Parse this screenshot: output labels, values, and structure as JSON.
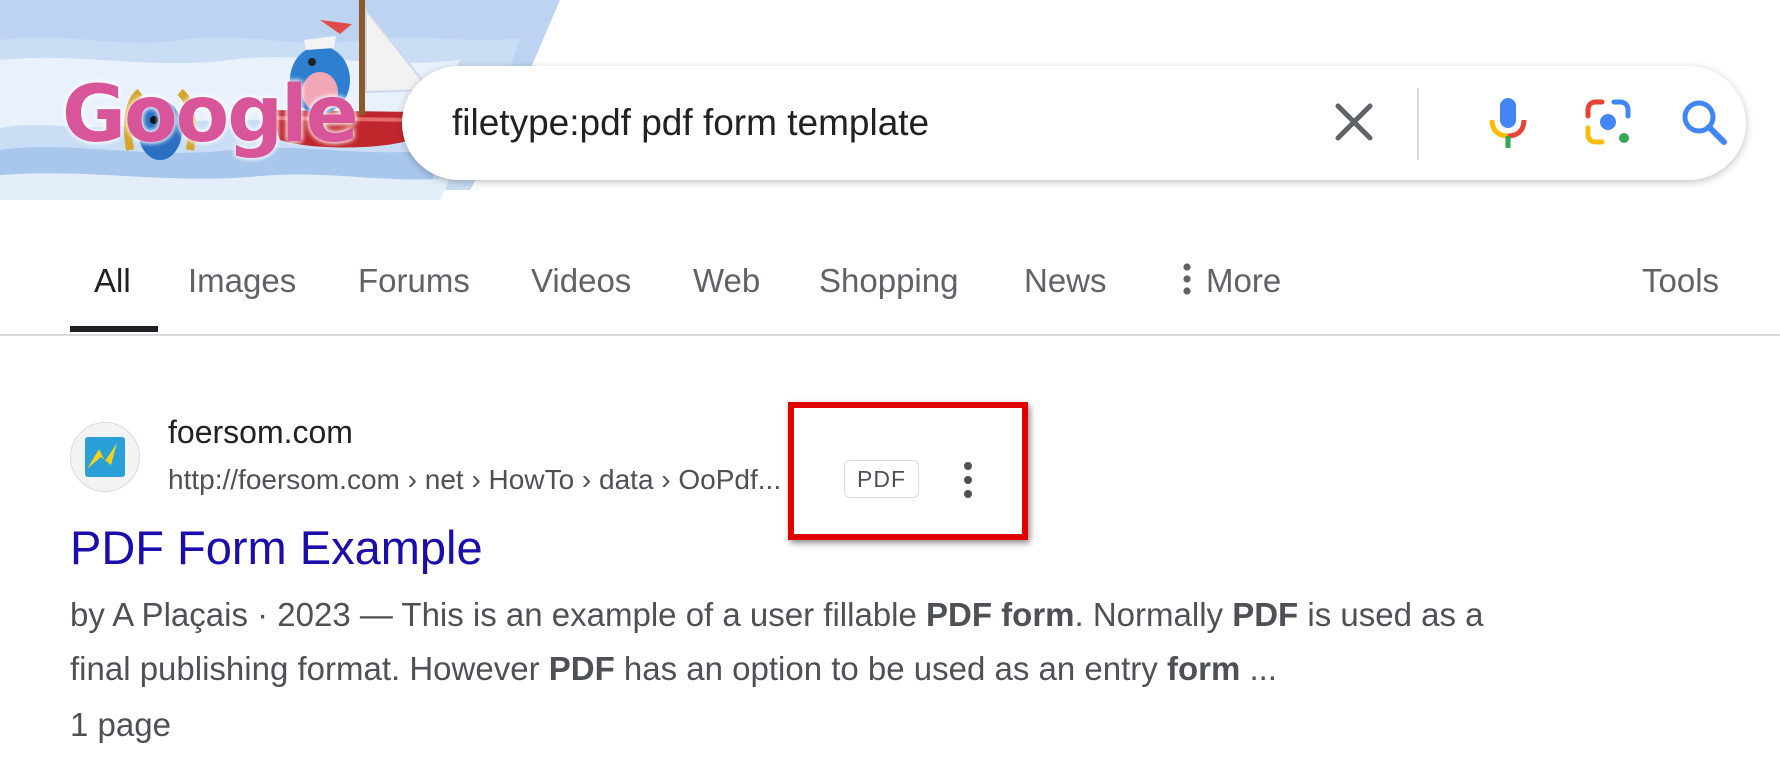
{
  "doodle": {
    "logo_text": "Google"
  },
  "search": {
    "query": "filetype:pdf pdf form template",
    "clear_icon": "close-icon",
    "voice_icon": "mic-icon",
    "lens_icon": "camera-lens-icon",
    "submit_icon": "search-icon"
  },
  "tabs": {
    "items": [
      {
        "label": "All",
        "active": true
      },
      {
        "label": "Images"
      },
      {
        "label": "Forums"
      },
      {
        "label": "Videos"
      },
      {
        "label": "Web"
      },
      {
        "label": "Shopping"
      },
      {
        "label": "News"
      },
      {
        "label": "More",
        "icon": "vertical-dots-icon"
      }
    ],
    "tools_label": "Tools"
  },
  "result": {
    "site_name": "foersom.com",
    "url": "http://foersom.com › net › HowTo › data › OoPdf...",
    "badge": "PDF",
    "title": "PDF Form Example",
    "snippet": {
      "line1": [
        {
          "text": "by A Plaçais · 2023 — This is an example of a user fillable ",
          "bold": false
        },
        {
          "text": "PDF form",
          "bold": true
        },
        {
          "text": ". Normally ",
          "bold": false
        },
        {
          "text": "PDF",
          "bold": true
        },
        {
          "text": " is used as a",
          "bold": false
        }
      ],
      "line2": [
        {
          "text": "final publishing format. However ",
          "bold": false
        },
        {
          "text": "PDF",
          "bold": true
        },
        {
          "text": " has an option to be used as an entry ",
          "bold": false
        },
        {
          "text": "form",
          "bold": true
        },
        {
          "text": " ...",
          "bold": false
        }
      ]
    },
    "pages": "1 page"
  },
  "colors": {
    "link": "#1a0dab",
    "highlight": "#e00000",
    "tab_active": "#202124",
    "muted": "#5f6368"
  }
}
